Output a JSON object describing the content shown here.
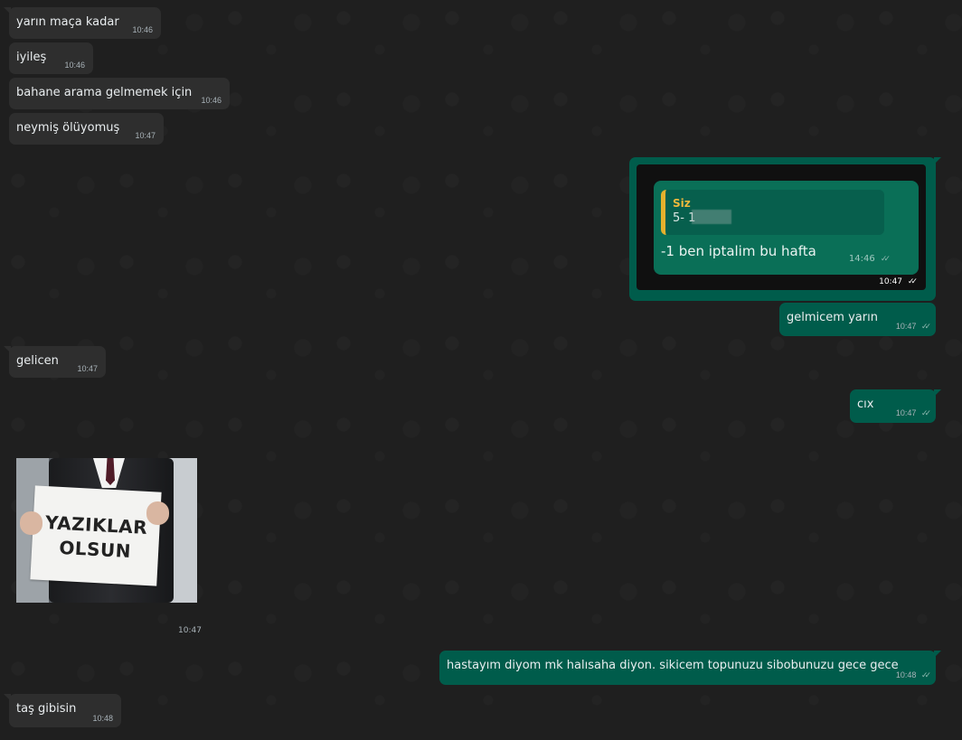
{
  "messages": {
    "m1": {
      "text": "yarın maça kadar",
      "time": "10:46"
    },
    "m2": {
      "text": "iyileş",
      "time": "10:46"
    },
    "m3": {
      "text": "bahane arama gelmemek için",
      "time": "10:46"
    },
    "m4": {
      "text": "neymiş ölüyomuş",
      "time": "10:47"
    },
    "m5": {
      "time": "10:47",
      "reply": {
        "label": "Siz",
        "text": "5- 1",
        "main": "-1 ben iptalim bu hafta",
        "time": "14:46"
      }
    },
    "m6": {
      "text": "gelmicem yarın",
      "time": "10:47"
    },
    "m7": {
      "text": "gelicen",
      "time": "10:47"
    },
    "m8": {
      "text": "cıx",
      "time": "10:47"
    },
    "m9": {
      "time": "10:47",
      "image_text_line1": "YAZIKLAR",
      "image_text_line2": "OLSUN"
    },
    "m10": {
      "text": "hastayım diyom mk halısaha diyon. sikicem topunuzu sibobunuzu gece gece",
      "time": "10:48"
    },
    "m11": {
      "text": "taş gibisin",
      "time": "10:48"
    }
  },
  "colors": {
    "background": "#1f1f1f",
    "incoming_bubble": "#2e2e2e",
    "outgoing_bubble": "#005c4b",
    "reply_accent": "#e5b12d"
  }
}
